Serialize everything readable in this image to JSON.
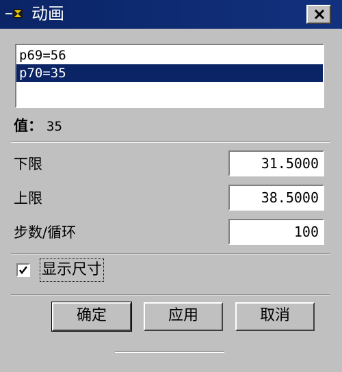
{
  "window": {
    "title": "动画",
    "icon": "animation-hourglass-icon",
    "close_icon": "close-icon"
  },
  "list": {
    "items": [
      {
        "label": "p69=56",
        "selected": false
      },
      {
        "label": "p70=35",
        "selected": true
      }
    ]
  },
  "value": {
    "label": "值：",
    "number": "35"
  },
  "fields": {
    "lower": {
      "label": "下限",
      "value": "31.5000"
    },
    "upper": {
      "label": "上限",
      "value": "38.5000"
    },
    "steps": {
      "label": "步数/循环",
      "value": "100"
    }
  },
  "checkbox": {
    "label": "显示尺寸",
    "checked": true
  },
  "buttons": {
    "ok": "确定",
    "apply": "应用",
    "cancel": "取消"
  },
  "colors": {
    "title_bar": "#0a2466",
    "selection": "#0a2466",
    "face": "#c0c0c0"
  }
}
